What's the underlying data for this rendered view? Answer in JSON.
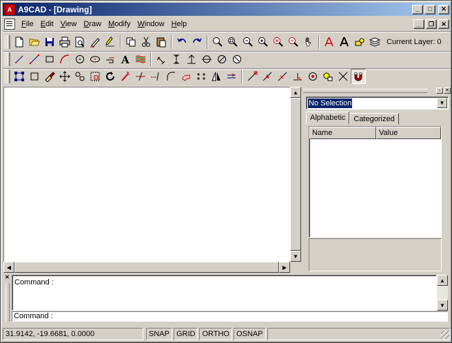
{
  "window": {
    "title": "A9CAD - [Drawing]",
    "app_icon": "a9cad-logo-icon",
    "caption_buttons": {
      "minimize": "_",
      "maximize": "□",
      "close": "✕"
    }
  },
  "menu": {
    "items": [
      {
        "label": "File",
        "key": "F"
      },
      {
        "label": "Edit",
        "key": "E"
      },
      {
        "label": "View",
        "key": "V"
      },
      {
        "label": "Draw",
        "key": "D"
      },
      {
        "label": "Modify",
        "key": "M"
      },
      {
        "label": "Window",
        "key": "W"
      },
      {
        "label": "Help",
        "key": "H"
      }
    ],
    "mdi_buttons": {
      "minimize": "_",
      "restore": "❐",
      "close": "✕"
    }
  },
  "toolbar_standard": {
    "current_layer_label": "Current Layer: 0"
  },
  "properties": {
    "selection": "No Selection",
    "tabs": [
      "Alphabetic",
      "Categorized"
    ],
    "columns": [
      "Name",
      "Value"
    ]
  },
  "command": {
    "history_line": "Command :",
    "prompt": "Command :"
  },
  "status": {
    "coordinates": "31.9142, -19.6681, 0.0000",
    "toggles": [
      "SNAP",
      "GRID",
      "ORTHO",
      "OSNAP"
    ]
  },
  "colors": {
    "title_start": "#0a246a",
    "title_end": "#a6caf0",
    "face": "#d4d0c8",
    "selection_bg": "#0a246a"
  }
}
